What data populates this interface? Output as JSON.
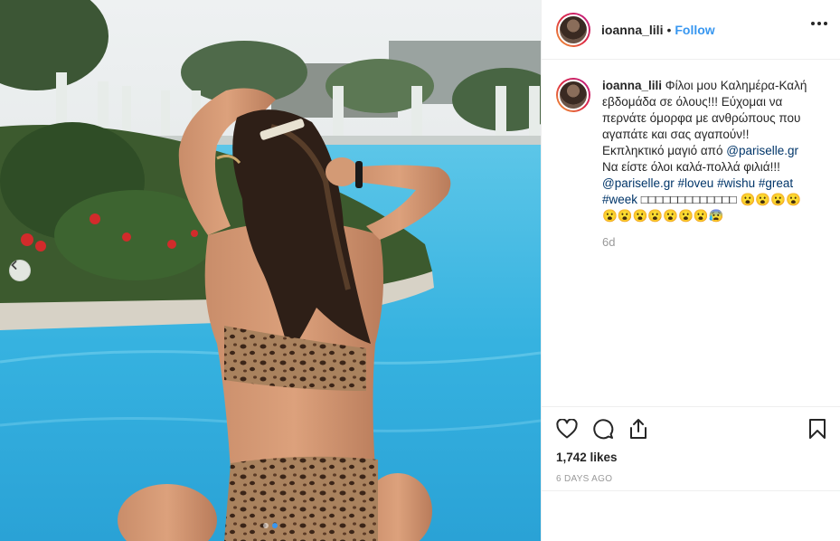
{
  "post": {
    "username": "ioanna_lili",
    "separator": "•",
    "follow_label": "Follow",
    "caption_username": "ioanna_lili",
    "caption_parts": [
      "Φίλοι μου Καλημέρα-Καλή εβδομάδα σε όλους!!! Εύχομαι να περνάτε όμορφα με ανθρώπους που αγαπάτε και σας αγαπούν!! Εκπληκτικό μαγιό από ",
      "@pariselle.gr",
      " Να είστε όλοι καλά-πολλά φιλιά!!! ",
      "@pariselle.gr",
      " ",
      "#loveu",
      " ",
      "#wishu",
      " ",
      "#great",
      " ",
      "#week",
      " □□□□□□□□□□□□□ 😮😮😮😮😮😮😮😮😮😮😮😰"
    ],
    "time_ago": "6d",
    "likes": "1,742 likes",
    "date": "6 DAYS AGO"
  },
  "icons": {
    "like": "heart-icon",
    "comment": "comment-icon",
    "share": "share-icon",
    "save": "bookmark-icon",
    "more": "more-options-icon",
    "prev": "chevron-left-icon"
  },
  "carousel": {
    "count": 2,
    "active": 2
  },
  "colors": {
    "link": "#3897f0",
    "mention": "#003569",
    "muted": "#999999"
  }
}
